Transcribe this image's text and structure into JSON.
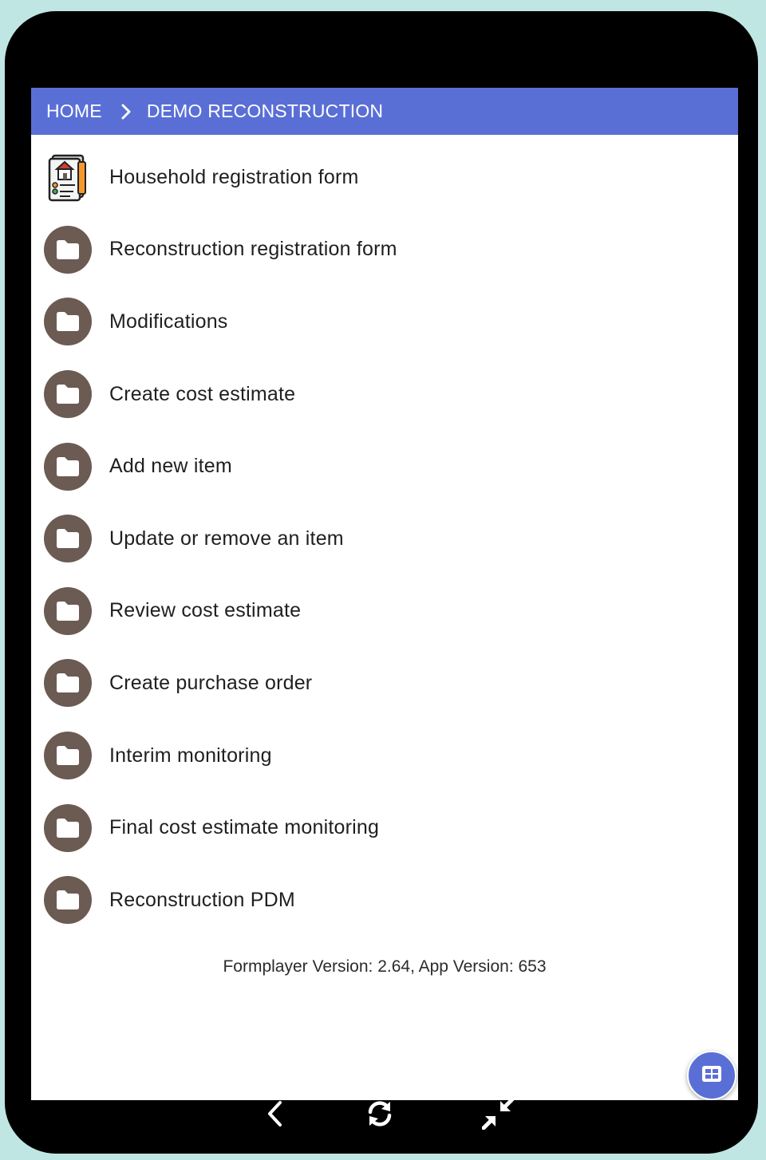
{
  "breadcrumb": {
    "home": "HOME",
    "current": "DEMO RECONSTRUCTION"
  },
  "menu": {
    "items": [
      {
        "label": "Household registration form",
        "icon": "registration-form-icon"
      },
      {
        "label": "Reconstruction registration form",
        "icon": "folder-icon"
      },
      {
        "label": "Modifications",
        "icon": "folder-icon"
      },
      {
        "label": "Create cost estimate",
        "icon": "folder-icon"
      },
      {
        "label": "Add new item",
        "icon": "folder-icon"
      },
      {
        "label": "Update or remove an item",
        "icon": "folder-icon"
      },
      {
        "label": "Review cost estimate",
        "icon": "folder-icon"
      },
      {
        "label": "Create purchase order",
        "icon": "folder-icon"
      },
      {
        "label": "Interim monitoring",
        "icon": "folder-icon"
      },
      {
        "label": "Final cost estimate monitoring",
        "icon": "folder-icon"
      },
      {
        "label": "Reconstruction PDM",
        "icon": "folder-icon"
      }
    ]
  },
  "footer": {
    "version": "Formplayer Version: 2.64, App Version: 653"
  },
  "colors": {
    "header": "#5a6fd6",
    "folder_circle": "#6b5b53",
    "fab": "#5a6fd6"
  },
  "nav": {
    "back": "back-icon",
    "refresh": "refresh-icon",
    "minimize": "minimize-icon"
  }
}
